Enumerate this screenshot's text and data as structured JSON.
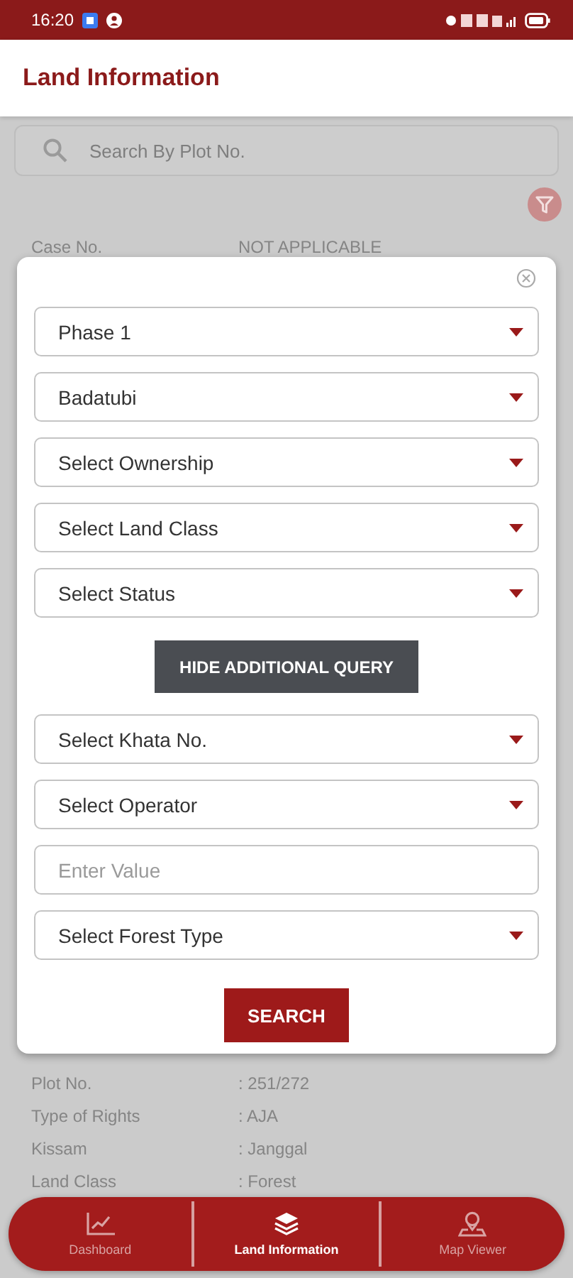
{
  "status_bar": {
    "time": "16:20"
  },
  "header": {
    "title": "Land Information"
  },
  "search": {
    "placeholder": "Search By Plot No."
  },
  "details_above": [
    {
      "label": "Case No.",
      "value": "NOT APPLICABLE"
    }
  ],
  "details_below": [
    {
      "label": "Plot No.",
      "value": ": 251/272"
    },
    {
      "label": "Type of Rights",
      "value": ": AJA"
    },
    {
      "label": "Kissam",
      "value": ": Janggal"
    },
    {
      "label": "Land Class",
      "value": ": Forest"
    }
  ],
  "filter_dialog": {
    "fields": [
      {
        "kind": "select",
        "value": "Phase 1"
      },
      {
        "kind": "select",
        "value": "Badatubi"
      },
      {
        "kind": "select",
        "value": "Select Ownership"
      },
      {
        "kind": "select",
        "value": "Select Land Class"
      },
      {
        "kind": "select",
        "value": "Select Status"
      },
      {
        "kind": "toggle",
        "label": "HIDE ADDITIONAL QUERY"
      },
      {
        "kind": "select",
        "value": "Select Khata No."
      },
      {
        "kind": "select",
        "value": "Select Operator"
      },
      {
        "kind": "input",
        "placeholder": "Enter Value"
      },
      {
        "kind": "select",
        "value": "Select Forest Type"
      }
    ],
    "search_button": "SEARCH"
  },
  "bottom_nav": [
    {
      "label": "Dashboard",
      "selected": false
    },
    {
      "label": "Land Information",
      "selected": true
    },
    {
      "label": "Map Viewer",
      "selected": false
    }
  ]
}
